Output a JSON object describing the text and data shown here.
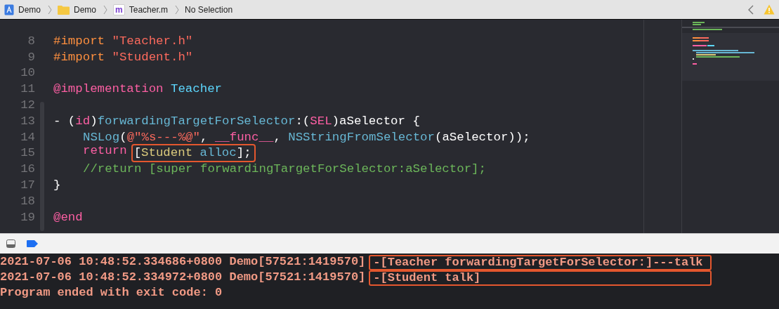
{
  "breadcrumb": [
    {
      "kind": "project",
      "label": "Demo"
    },
    {
      "kind": "folder",
      "label": "Demo"
    },
    {
      "kind": "file",
      "badge": "m",
      "label": "Teacher.m"
    },
    {
      "kind": "plain",
      "label": "No Selection"
    }
  ],
  "editor": {
    "lines": [
      {
        "number": "8",
        "indented": false,
        "parts": [
          {
            "boxed": false,
            "tokens": [
              {
                "kind": "preproc",
                "text": "#import "
              },
              {
                "kind": "string",
                "text": "\"Teacher.h\""
              }
            ]
          }
        ]
      },
      {
        "number": "9",
        "indented": false,
        "parts": [
          {
            "boxed": false,
            "tokens": [
              {
                "kind": "preproc",
                "text": "#import "
              },
              {
                "kind": "string",
                "text": "\"Student.h\""
              }
            ]
          }
        ]
      },
      {
        "number": "10"
      },
      {
        "number": "11",
        "indented": false,
        "parts": [
          {
            "boxed": false,
            "tokens": [
              {
                "kind": "keyword",
                "text": "@implementation "
              },
              {
                "kind": "class",
                "text": "Teacher"
              }
            ]
          }
        ]
      },
      {
        "number": "12"
      },
      {
        "number": "13",
        "indented": false,
        "parts": [
          {
            "boxed": false,
            "tokens": [
              {
                "kind": "plain",
                "text": "- ("
              },
              {
                "kind": "keyword",
                "text": "id"
              },
              {
                "kind": "plain",
                "text": ")"
              },
              {
                "kind": "method",
                "text": "forwardingTargetForSelector"
              },
              {
                "kind": "plain",
                "text": ":("
              },
              {
                "kind": "keyword",
                "text": "SEL"
              },
              {
                "kind": "plain",
                "text": ")aSelector {"
              }
            ]
          }
        ]
      },
      {
        "number": "14",
        "indented": true,
        "parts": [
          {
            "boxed": false,
            "tokens": [
              {
                "kind": "method",
                "text": "NSLog"
              },
              {
                "kind": "plain",
                "text": "("
              },
              {
                "kind": "string",
                "text": "@\"%s---%@\""
              },
              {
                "kind": "plain",
                "text": ", "
              },
              {
                "kind": "keyword",
                "text": "__func__"
              },
              {
                "kind": "plain",
                "text": ", "
              },
              {
                "kind": "method",
                "text": "NSStringFromSelector"
              },
              {
                "kind": "plain",
                "text": "(aSelector));"
              }
            ]
          }
        ]
      },
      {
        "number": "15",
        "indented": true,
        "parts": [
          {
            "boxed": false,
            "tokens": [
              {
                "kind": "keyword",
                "text": "return"
              }
            ]
          },
          {
            "boxed": true,
            "tokens": [
              {
                "kind": "plain",
                "text": "["
              },
              {
                "kind": "project_class",
                "text": "Student"
              },
              {
                "kind": "method",
                "text": " alloc"
              },
              {
                "kind": "plain",
                "text": "];"
              }
            ]
          }
        ]
      },
      {
        "number": "16",
        "indented": true,
        "parts": [
          {
            "boxed": false,
            "tokens": [
              {
                "kind": "comment",
                "text": "//return [super forwardingTargetForSelector:aSelector];"
              }
            ]
          }
        ]
      },
      {
        "number": "17",
        "indented": false,
        "parts": [
          {
            "boxed": false,
            "tokens": [
              {
                "kind": "plain",
                "text": "}"
              }
            ]
          }
        ]
      },
      {
        "number": "18"
      },
      {
        "number": "19",
        "indented": false,
        "parts": [
          {
            "boxed": false,
            "tokens": [
              {
                "kind": "keyword",
                "text": "@end"
              }
            ]
          }
        ]
      }
    ]
  },
  "console": {
    "lines": [
      {
        "prefix": "2021-07-06 10:48:52.334686+0800 Demo[57521:1419570]",
        "message": "-[Teacher forwardingTargetForSelector:]---talk",
        "boxed": true
      },
      {
        "prefix": "2021-07-06 10:48:52.334972+0800 Demo[57521:1419570]",
        "message": "-[Student talk]",
        "boxed": true
      },
      {
        "prefix": "Program ended with exit code: 0"
      }
    ]
  }
}
